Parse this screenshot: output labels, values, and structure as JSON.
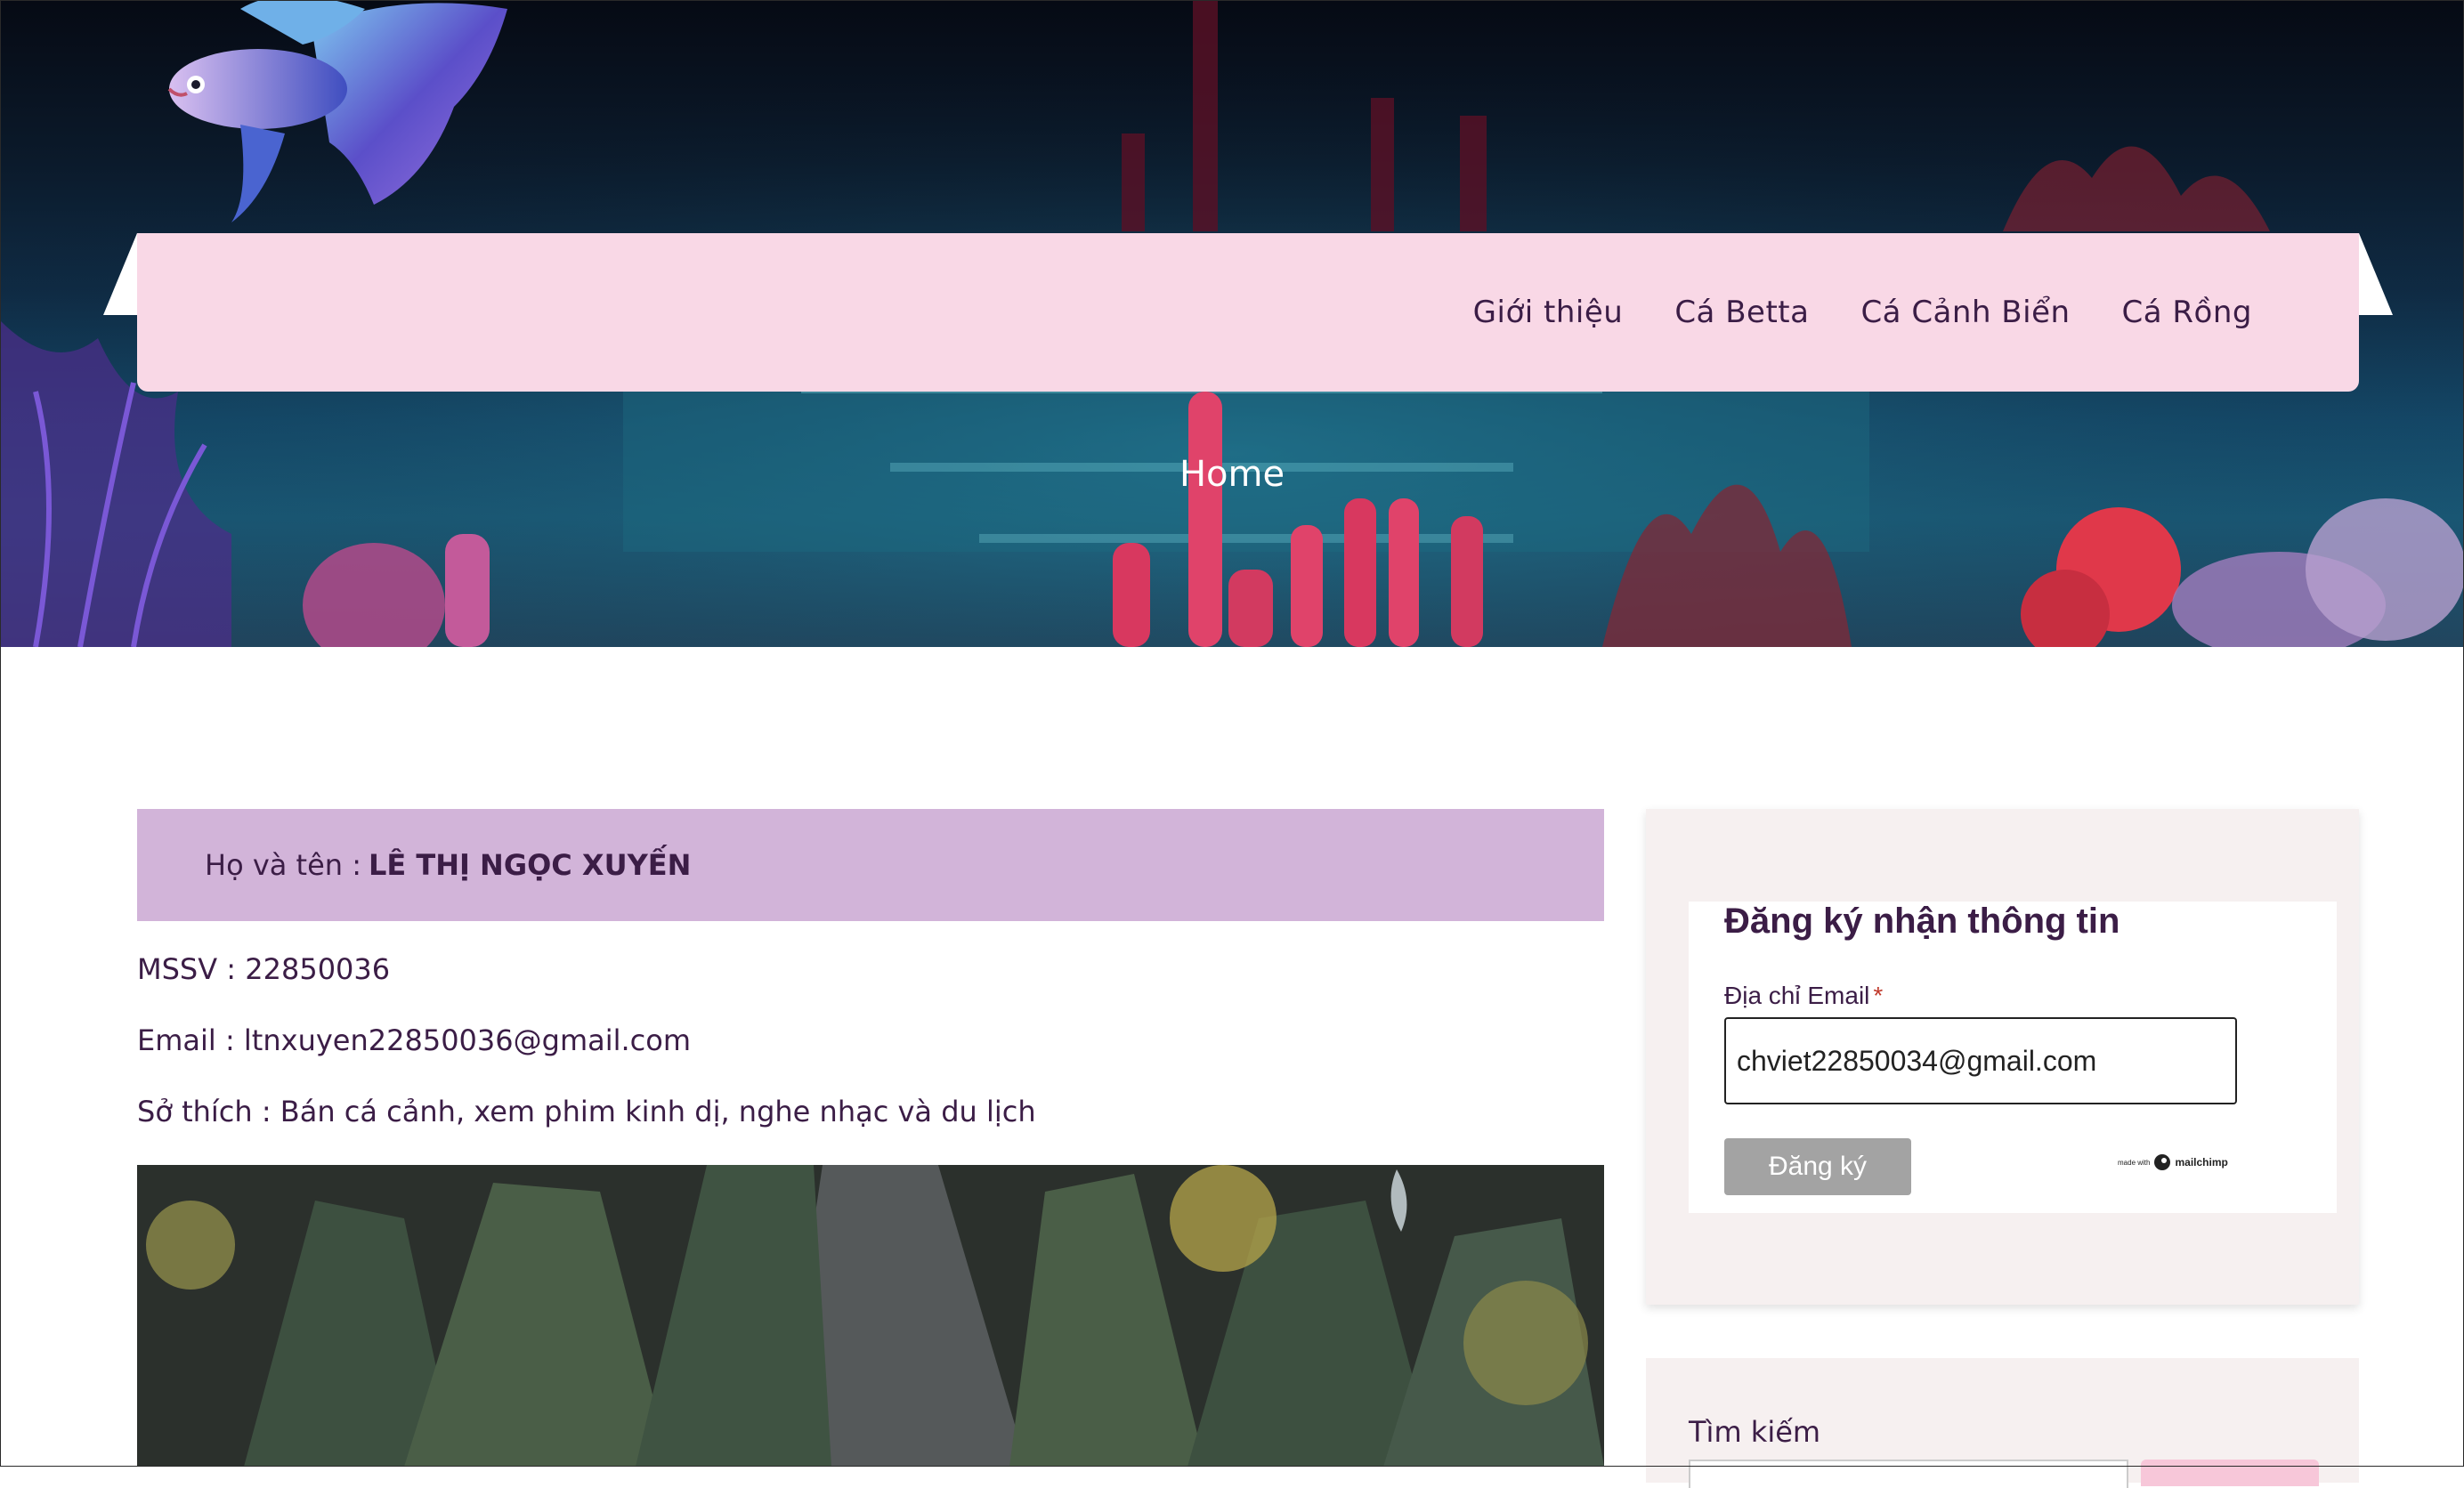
{
  "header": {
    "nav": [
      {
        "label": "Giới thiệu"
      },
      {
        "label": "Cá Betta"
      },
      {
        "label": "Cá Cảnh Biển"
      },
      {
        "label": "Cá Rồng"
      }
    ],
    "hero_title": "Home"
  },
  "profile": {
    "name_label": "Họ và tên :",
    "name_value": "LÊ THỊ NGỌC XUYẾN",
    "mssv": "MSSV : 22850036",
    "email": "Email : ltnxuyen22850036@gmail.com",
    "hobbies": "Sở thích : Bán cá cảnh, xem phim kinh dị, nghe nhạc và du lịch"
  },
  "subscribe": {
    "title": "Đăng ký nhận thông tin",
    "email_label": "Địa chỉ Email",
    "required_mark": "*",
    "email_value": "chviet22850034@gmail.com",
    "button_label": "Đăng ký",
    "badge_small": "made with",
    "badge_brand": "mailchimp"
  },
  "search": {
    "label": "Tìm kiếm"
  },
  "colors": {
    "navbar": "#f9d8e6",
    "name_box": "#d2b4d9",
    "text": "#3b1d46",
    "widget_bg": "#f6f0f0",
    "button_gray": "#a3a3a3"
  }
}
